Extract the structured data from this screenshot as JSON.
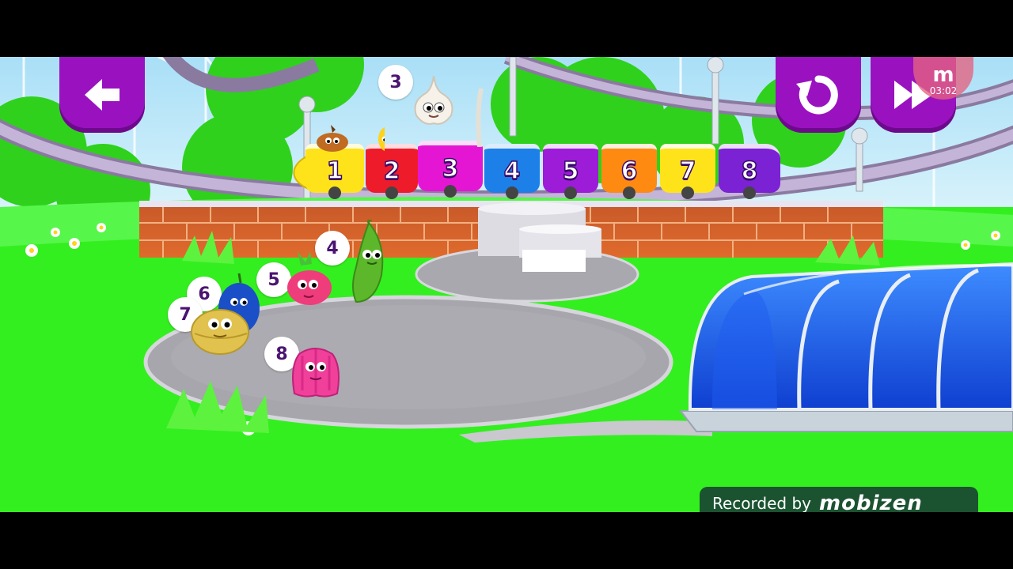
{
  "ui": {
    "back_button_icon": "arrow-left-icon",
    "restart_button_icon": "restart-icon",
    "skip_button_icon": "fast-forward-icon",
    "recorder_logo": "m",
    "recorder_time": "03:02",
    "watermark": {
      "prefix": "Recorded by",
      "brand": "mobizen"
    }
  },
  "train": {
    "cars": [
      {
        "number": "1",
        "color": "#ffe31a"
      },
      {
        "number": "2",
        "color": "#ee1c2a"
      },
      {
        "number": "3",
        "color": "#e516d3"
      },
      {
        "number": "4",
        "color": "#1d7fe8"
      },
      {
        "number": "5",
        "color": "#9d1cd8"
      },
      {
        "number": "6",
        "color": "#ff8a12"
      },
      {
        "number": "7",
        "color": "#ffe31a"
      },
      {
        "number": "8",
        "color": "#7a22d4"
      }
    ]
  },
  "characters": [
    {
      "name": "garlic",
      "number": "3"
    },
    {
      "name": "pea-pod",
      "number": "4"
    },
    {
      "name": "radish",
      "number": "5"
    },
    {
      "name": "blue-plum",
      "number": "6"
    },
    {
      "name": "yellow-bun",
      "number": "7"
    },
    {
      "name": "pink-jelly",
      "number": "8"
    }
  ],
  "colors": {
    "grass": "#33ef1f",
    "button_purple": "#9a12c0",
    "watermark_bg": "#1b5331"
  }
}
